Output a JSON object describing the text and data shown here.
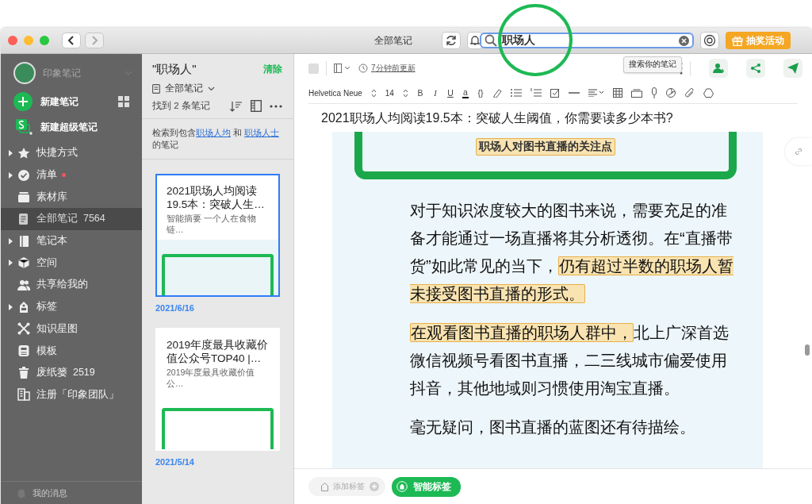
{
  "window": {
    "title": "全部笔记"
  },
  "search": {
    "value": "职场人",
    "tooltip": "搜索你的笔记"
  },
  "promo_button": {
    "label": "抽奖活动"
  },
  "sidebar": {
    "account": "印象笔记",
    "new_note": "新建笔记",
    "new_super_note": "新建超级笔记",
    "items": [
      {
        "label": "快捷方式",
        "expandable": true,
        "selected": false,
        "dot": false
      },
      {
        "label": "清单",
        "expandable": true,
        "selected": false,
        "dot": true
      },
      {
        "label": "素材库",
        "expandable": false,
        "selected": false,
        "dot": false
      },
      {
        "label": "全部笔记",
        "count": "7564",
        "expandable": false,
        "selected": true,
        "dot": false
      },
      {
        "label": "笔记本",
        "expandable": true,
        "selected": false,
        "dot": false
      },
      {
        "label": "空间",
        "expandable": true,
        "selected": false,
        "dot": false
      },
      {
        "label": "共享给我的",
        "expandable": false,
        "selected": false,
        "dot": false
      },
      {
        "label": "标签",
        "expandable": true,
        "selected": false,
        "dot": false
      },
      {
        "label": "知识星图",
        "expandable": false,
        "selected": false,
        "dot": false
      },
      {
        "label": "模板",
        "expandable": false,
        "selected": false,
        "dot": false
      },
      {
        "label": "废纸篓",
        "count": "2519",
        "expandable": false,
        "selected": false,
        "dot": false
      },
      {
        "label": "注册「印象团队」",
        "expandable": false,
        "selected": false,
        "dot": false
      }
    ],
    "messages": "我的消息"
  },
  "note_list": {
    "query": "\"职场人\"",
    "clear": "清除",
    "scope": "全部笔记",
    "result_count": "找到 2 条笔记",
    "hint": [
      {
        "text": "检索到包含",
        "link": false
      },
      {
        "text": "职场人均",
        "link": true
      },
      {
        "text": " 和 ",
        "link": false
      },
      {
        "text": "职场人士",
        "link": true
      },
      {
        "text": "的笔记",
        "link": false
      }
    ],
    "notes": [
      {
        "title": "2021职场人均阅读19.5本：突破人生…",
        "summary": "智能摘要 一个人在食物链…",
        "date": "2021/6/16",
        "selected": true
      },
      {
        "title": "2019年度最具收藏价值公众号TOP40 |…",
        "summary": "2019年度最具收藏价值公…",
        "date": "2021/5/14",
        "selected": false
      }
    ]
  },
  "editor": {
    "updated": "7分钟前更新",
    "font": "Helvetica Neue",
    "size": "14",
    "format_buttons": [
      "B",
      "I",
      "U",
      "a",
      "{}"
    ],
    "title": "2021职场人均阅读19.5本：突破人生阈值，你需要读多少本书?",
    "image_highlight": "职场人对图书直播的关注点",
    "paragraphs": [
      [
        {
          "text": "对于知识浓度较大的图书来说，需要充足的准备才能通过一场直播将其分析透彻。在“直播带货”如此常见的当下，",
          "highlighted": false
        },
        {
          "text": "仍有超过半数的职场人暂未接受图书直播的形式。",
          "highlighted": true
        }
      ],
      [
        {
          "text": "在观看图书直播的职场人群中，",
          "highlighted": true
        },
        {
          "text": "北上广深首选微信视频号看图书直播，二三线城市偏爱使用抖音，其他地域则习惯使用淘宝直播。",
          "highlighted": false
        }
      ],
      [
        {
          "text": "毫无疑问，图书直播的蓝图还有待描绘。",
          "highlighted": false
        }
      ]
    ],
    "add_tag": "添加标签",
    "smart_tag": "智能标签"
  }
}
